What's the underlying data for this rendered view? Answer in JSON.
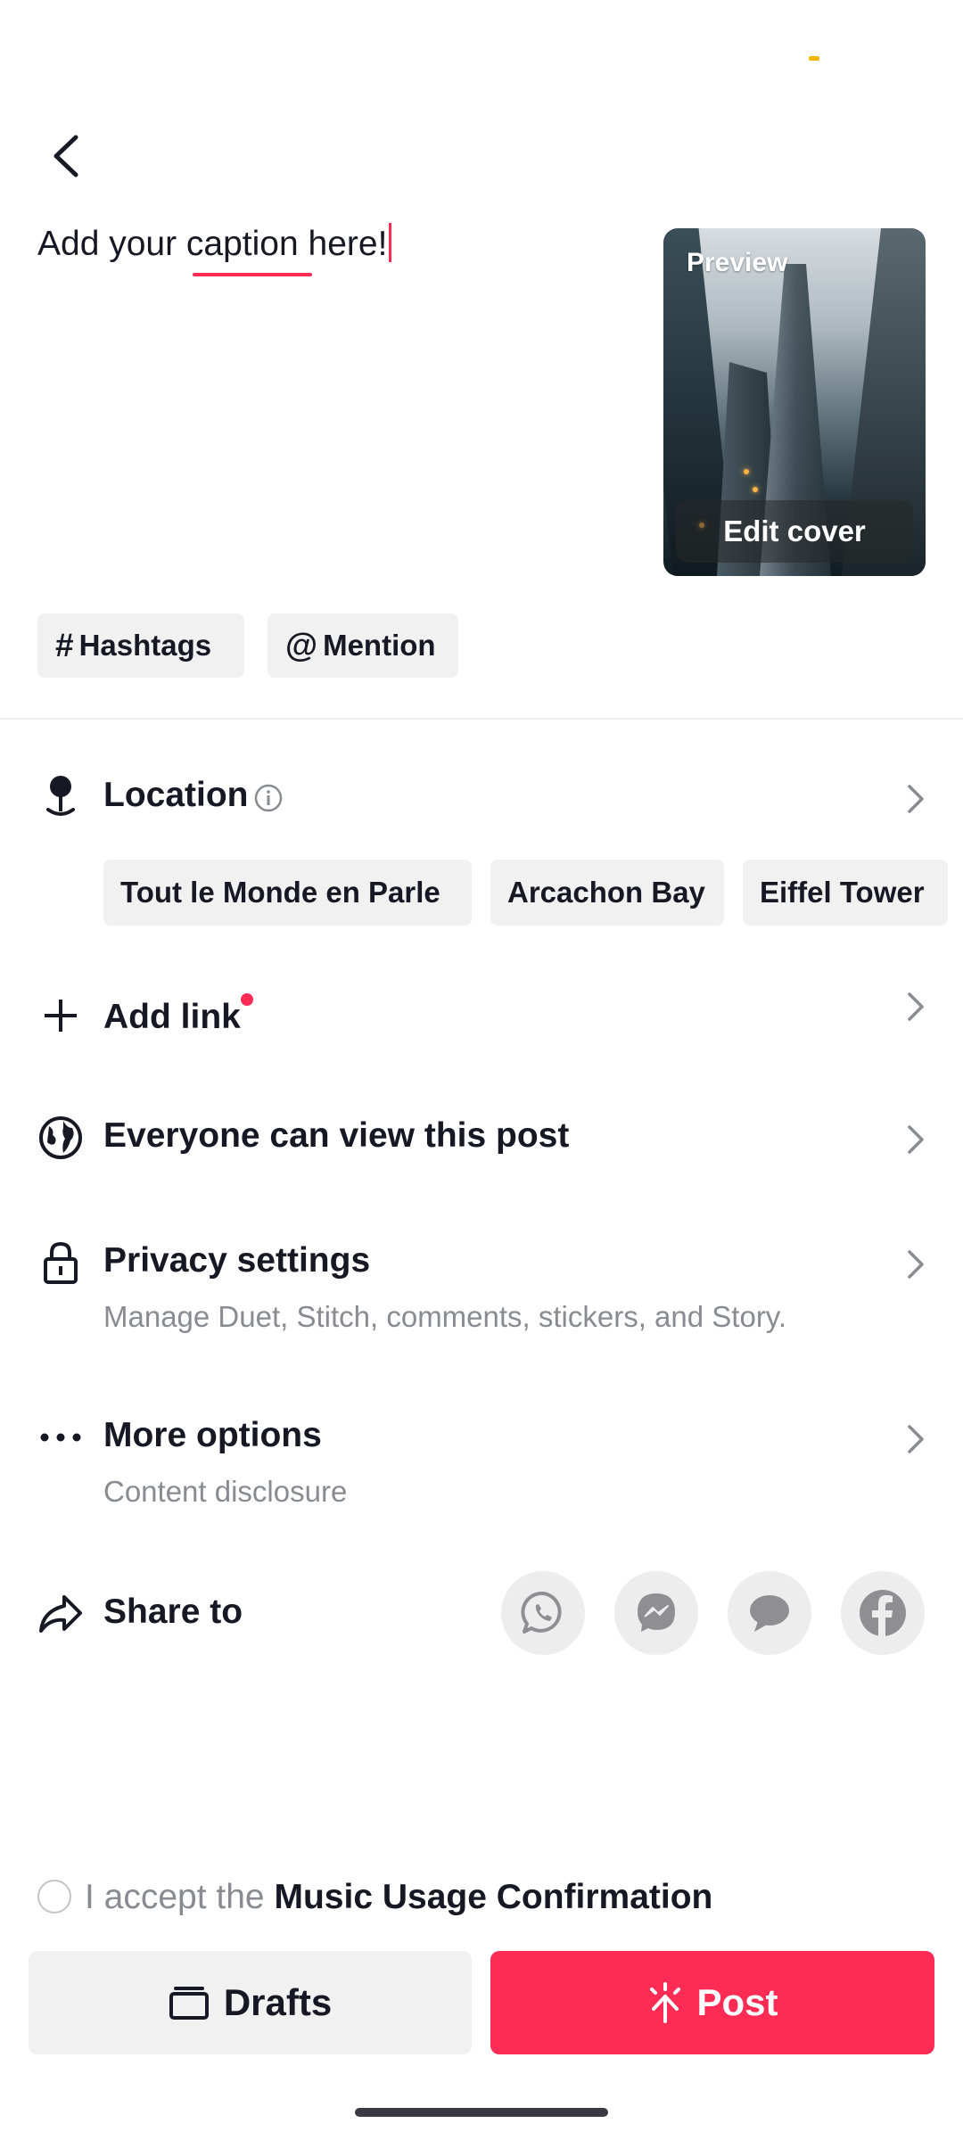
{
  "caption": {
    "text": "Add your caption here!"
  },
  "cover": {
    "preview_label": "Preview",
    "edit_cover_label": "Edit cover"
  },
  "chips": {
    "hashtags": "Hashtags",
    "mention": "Mention"
  },
  "location": {
    "title": "Location",
    "suggestions": [
      "Tout le Monde en Parle",
      "Arcachon Bay",
      "Eiffel Tower"
    ]
  },
  "add_link": {
    "title": "Add link"
  },
  "visibility": {
    "title": "Everyone can view this post"
  },
  "privacy": {
    "title": "Privacy settings",
    "subtitle": "Manage Duet, Stitch, comments, stickers, and Story."
  },
  "more_options": {
    "title": "More options",
    "subtitle": "Content disclosure"
  },
  "share": {
    "title": "Share to",
    "targets": [
      "whatsapp-icon",
      "messenger-icon",
      "message-icon",
      "facebook-icon"
    ]
  },
  "music_confirmation": {
    "prefix": "I accept the",
    "link": "Music Usage Confirmation"
  },
  "actions": {
    "drafts_label": "Drafts",
    "post_label": "Post"
  },
  "colors": {
    "accent": "#fe2c55",
    "chip_bg": "#f1f1f2",
    "secondary_text": "#8a8b91"
  }
}
